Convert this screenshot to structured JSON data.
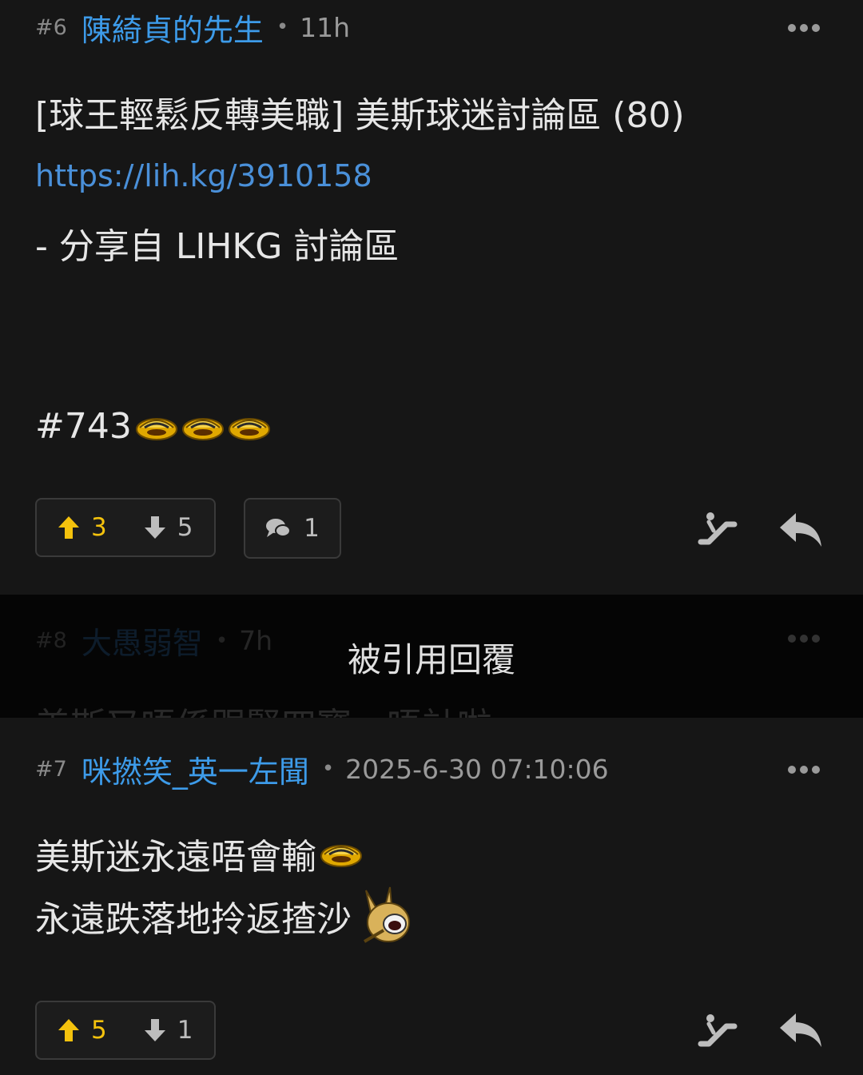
{
  "post1": {
    "floor": "#6",
    "author": "陳綺貞的先生",
    "time": "11h",
    "title": "[球王輕鬆反轉美職] 美斯球迷討論區 (80)",
    "link": "https://lih.kg/3910158",
    "share": "- 分享自 LIHKG 討論區",
    "ref": "#743",
    "emojis": [
      "laugh-emoji",
      "laugh-emoji",
      "laugh-emoji"
    ],
    "upvotes": "3",
    "downvotes": "5",
    "comments": "1"
  },
  "quoted": {
    "banner": "被引用回覆",
    "floor": "#8",
    "author": "大愚弱智",
    "time": "7h",
    "text": "美斯又唔係跟緊四寶，唔計啦"
  },
  "post2": {
    "floor": "#7",
    "author": "咪撚笑_英一左聞",
    "time": "2025-6-30 07:10:06",
    "line1": "美斯迷永遠唔會輸",
    "line2": "永遠跌落地拎返揸沙",
    "upvotes": "5",
    "downvotes": "1"
  },
  "colors": {
    "author": "#3d9be9",
    "link": "#4a90d9",
    "upvote": "#f4c20d",
    "background": "#161616"
  }
}
